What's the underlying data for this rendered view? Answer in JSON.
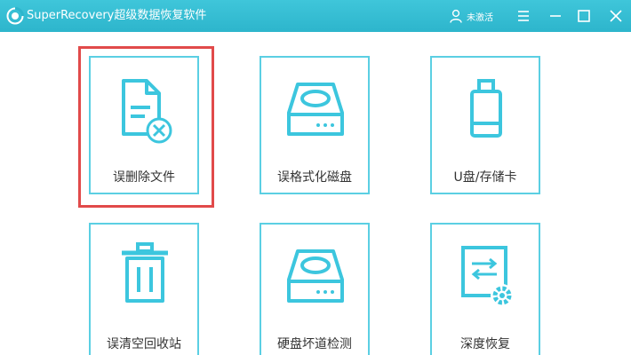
{
  "app": {
    "title": "SuperRecovery超级数据恢复软件",
    "icon": "app-logo-icon",
    "user_label": "未激活",
    "user_icon": "user-icon"
  },
  "window_controls": [
    "menu-icon",
    "minimize-icon",
    "maximize-icon",
    "close-icon"
  ],
  "colors": {
    "titlebar": "#35bcd2",
    "card_border": "#5bcfe3",
    "icon": "#3cc6de",
    "selection": "#e14a4a"
  },
  "cards": [
    {
      "label": "误删除文件",
      "icon": "deleted-file-icon",
      "selected": true
    },
    {
      "label": "误格式化磁盘",
      "icon": "disk-icon",
      "selected": false
    },
    {
      "label": "U盘/存储卡",
      "icon": "usb-drive-icon",
      "selected": false
    },
    {
      "label": "误清空回收站",
      "icon": "trash-icon",
      "selected": false
    },
    {
      "label": "硬盘坏道检测",
      "icon": "disk-check-icon",
      "selected": false
    },
    {
      "label": "深度恢复",
      "icon": "deep-recovery-icon",
      "selected": false
    }
  ]
}
